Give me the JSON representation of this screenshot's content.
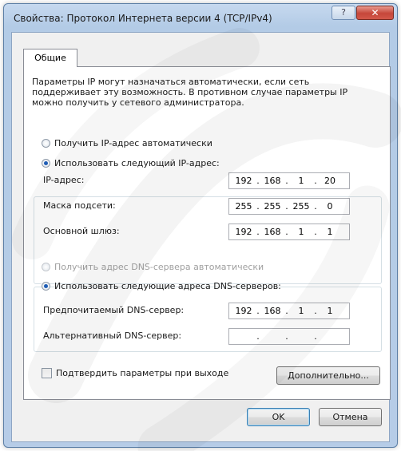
{
  "window": {
    "title": "Свойства: Протокол Интернета версии 4 (TCP/IPv4)",
    "help_label": "?",
    "close_label": "✕"
  },
  "tabs": [
    {
      "label": "Общие",
      "active": true
    }
  ],
  "description": "Параметры IP могут назначаться автоматически, если сеть поддерживает эту возможность. В противном случае параметры IP можно получить у сетевого администратора.",
  "ip_mode": {
    "auto_label": "Получить IP-адрес автоматически",
    "auto_selected": false,
    "manual_label": "Использовать следующий IP-адрес:",
    "manual_selected": true
  },
  "ip_fields": [
    {
      "label": "IP-адрес:",
      "octets": [
        "192",
        "168",
        "1",
        "20"
      ]
    },
    {
      "label": "Маска подсети:",
      "octets": [
        "255",
        "255",
        "255",
        "0"
      ]
    },
    {
      "label": "Основной шлюз:",
      "octets": [
        "192",
        "168",
        "1",
        "1"
      ]
    }
  ],
  "dns_mode": {
    "auto_label": "Получить адрес DNS-сервера автоматически",
    "auto_selected": false,
    "auto_disabled": true,
    "manual_label": "Использовать следующие адреса DNS-серверов:",
    "manual_selected": true
  },
  "dns_fields": [
    {
      "label": "Предпочитаемый DNS-сервер:",
      "octets": [
        "192",
        "168",
        "1",
        "1"
      ]
    },
    {
      "label": "Альтернативный DNS-сервер:",
      "octets": [
        "",
        "",
        "",
        ""
      ]
    }
  ],
  "validate_checkbox": {
    "label": "Подтвердить параметры при выходе",
    "checked": false
  },
  "buttons": {
    "advanced": "Дополнительно...",
    "ok": "OK",
    "cancel": "Отмена"
  },
  "colors": {
    "titlebar": "#b9cfe9",
    "close_button": "#c6473a",
    "radio_dot": "#1f5db5"
  },
  "icons": {
    "help": "question-mark-icon",
    "close": "close-icon"
  }
}
